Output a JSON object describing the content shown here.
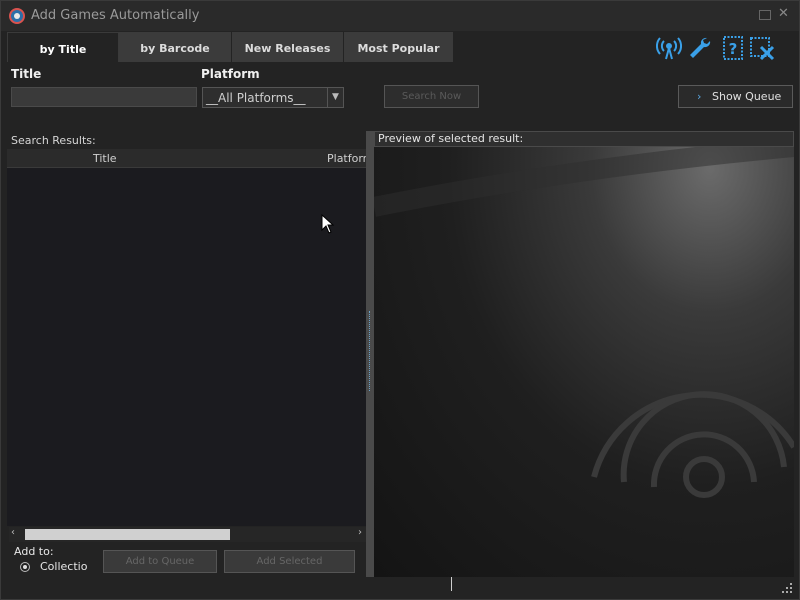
{
  "window": {
    "title": "Add Games Automatically"
  },
  "tabs": [
    {
      "label": "by Title"
    },
    {
      "label": "by Barcode"
    },
    {
      "label": "New Releases"
    },
    {
      "label": "Most Popular"
    }
  ],
  "toolbar": {
    "icons": [
      "wireless-icon",
      "wrench-icon",
      "help-icon",
      "close-window-icon"
    ]
  },
  "search": {
    "title_label": "Title",
    "title_value": "",
    "platform_label": "Platform",
    "platform_value": "__All Platforms__",
    "search_button": "Search Now",
    "show_queue_button": "Show Queue"
  },
  "results": {
    "label": "Search Results:",
    "columns": {
      "title": "Title",
      "platform": "Platform"
    },
    "rows": []
  },
  "add": {
    "label": "Add to:",
    "collection_option": "Collection",
    "add_queue_button": "Add to Queue",
    "add_selected_button": "Add Selected"
  },
  "preview": {
    "label": "Preview of selected result:"
  },
  "colors": {
    "accent": "#3aa0e8",
    "background": "#232323"
  }
}
